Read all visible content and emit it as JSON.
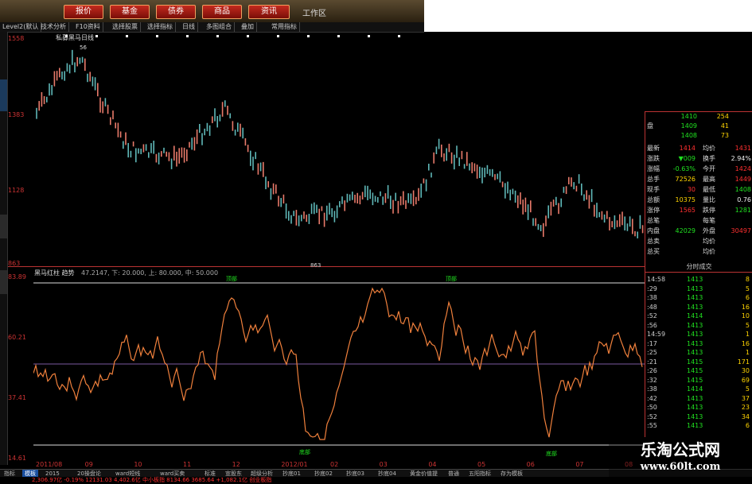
{
  "menu": {
    "buttons": [
      "报价",
      "基金",
      "债券",
      "商品",
      "资讯"
    ],
    "work_area": "工作区"
  },
  "toolbar": {
    "items": [
      "Level2(默认",
      "技术分析",
      "F10资料",
      "选择股票",
      "选择指标",
      "日线",
      "多图组合",
      "叠加",
      "常用指标"
    ]
  },
  "price_chart": {
    "title": "私募黑马日线",
    "y_labels": [
      "1558",
      "1383",
      "1128",
      "863"
    ],
    "high_marker": "56",
    "low_marker": "863"
  },
  "oscillator": {
    "title": "黑马红柱 趋势",
    "params": "47.2147, 下: 20.000, 上: 80.000, 中: 50.000",
    "y_labels": [
      "83.89",
      "60.21",
      "37.41",
      "14.61"
    ],
    "top_labels": [
      "顶部",
      "顶部"
    ],
    "bottom_labels": [
      "底部",
      "底部"
    ]
  },
  "quote": {
    "order_rows": [
      {
        "label": "",
        "price": "1410",
        "vol": "254"
      },
      {
        "label": "盘",
        "price": "1409",
        "vol": "41"
      },
      {
        "label": "",
        "price": "1408",
        "vol": "73"
      }
    ],
    "rows": [
      {
        "l": "最新",
        "m": "1414",
        "mc": "red",
        "ml": "均价",
        "r": "1431",
        "rc": "red"
      },
      {
        "l": "涨跌",
        "m": "▼009",
        "mc": "green",
        "ml": "换手",
        "r": "2.94%",
        "rc": "white"
      },
      {
        "l": "涨幅",
        "m": "-0.63%",
        "mc": "green",
        "ml": "今开",
        "r": "1424",
        "rc": "red"
      },
      {
        "l": "总手",
        "m": "72526",
        "mc": "yellow",
        "ml": "最高",
        "r": "1449",
        "rc": "red"
      },
      {
        "l": "现手",
        "m": "30",
        "mc": "red",
        "ml": "最低",
        "r": "1408",
        "rc": "green"
      },
      {
        "l": "总额",
        "m": "10375",
        "mc": "yellow",
        "ml": "量比",
        "r": "0.76",
        "rc": "white"
      },
      {
        "l": "涨停",
        "m": "1565",
        "mc": "red",
        "ml": "跌停",
        "r": "1281",
        "rc": "green"
      },
      {
        "l": "总笔",
        "m": "",
        "mc": "white",
        "ml": "每笔",
        "r": "",
        "rc": "white"
      },
      {
        "l": "内盘",
        "m": "42029",
        "mc": "green",
        "ml": "外盘",
        "r": "30497",
        "rc": "red"
      },
      {
        "l": "总卖",
        "m": "",
        "mc": "white",
        "ml": "均价",
        "r": "",
        "rc": "white"
      },
      {
        "l": "总买",
        "m": "",
        "mc": "white",
        "ml": "均价",
        "r": "",
        "rc": "white"
      }
    ]
  },
  "ticks": {
    "header": "分时成交",
    "rows": [
      {
        "t": "14:58",
        "p": "1413",
        "v": "8"
      },
      {
        "t": ":29",
        "p": "1413",
        "v": "5"
      },
      {
        "t": ":38",
        "p": "1413",
        "v": "6"
      },
      {
        "t": ":48",
        "p": "1413",
        "v": "16"
      },
      {
        "t": ":52",
        "p": "1414",
        "v": "10"
      },
      {
        "t": ":56",
        "p": "1413",
        "v": "5"
      },
      {
        "t": "14:59",
        "p": "1413",
        "v": "1"
      },
      {
        "t": ":17",
        "p": "1413",
        "v": "16"
      },
      {
        "t": ":25",
        "p": "1413",
        "v": "1"
      },
      {
        "t": ":21",
        "p": "1415",
        "v": "171"
      },
      {
        "t": ":26",
        "p": "1415",
        "v": "30"
      },
      {
        "t": ":32",
        "p": "1415",
        "v": "69"
      },
      {
        "t": ":38",
        "p": "1414",
        "v": "5"
      },
      {
        "t": ":42",
        "p": "1413",
        "v": "37"
      },
      {
        "t": ":50",
        "p": "1413",
        "v": "23"
      },
      {
        "t": ":52",
        "p": "1413",
        "v": "34"
      },
      {
        "t": ":55",
        "p": "1413",
        "v": "6"
      }
    ]
  },
  "xaxis": {
    "labels": [
      "2011/08",
      "09",
      "10",
      "11",
      "12",
      "2012/01",
      "02",
      "03",
      "04",
      "05",
      "06",
      "07",
      "08"
    ]
  },
  "tabs": {
    "items": [
      "指标",
      "模板",
      "2015",
      "20操盘论",
      "ward短线",
      "ward买卖",
      "标准",
      "宣股东",
      "超级分析",
      "抄底01",
      "抄底02",
      "抄底03",
      "抄底04",
      "黄金价值提",
      "普通",
      "五阳指标",
      "存为模板"
    ],
    "active_index": 1
  },
  "status": {
    "text": "2,306.97亿  -0.19%  12131.03  4,402.6亿  中小板指  8134.66  3685.64  +1,082.1亿 创业板指"
  },
  "watermark": {
    "title": "乐淘公式网",
    "url": "www.60lt.com"
  },
  "colors": {
    "rise": "#ff3030",
    "fall": "#20e020",
    "candle_up": "#e87a6a",
    "candle_down": "#5fb8b8",
    "oscillator_line": "#f0803c",
    "accent_red_border": "#b33333"
  }
}
